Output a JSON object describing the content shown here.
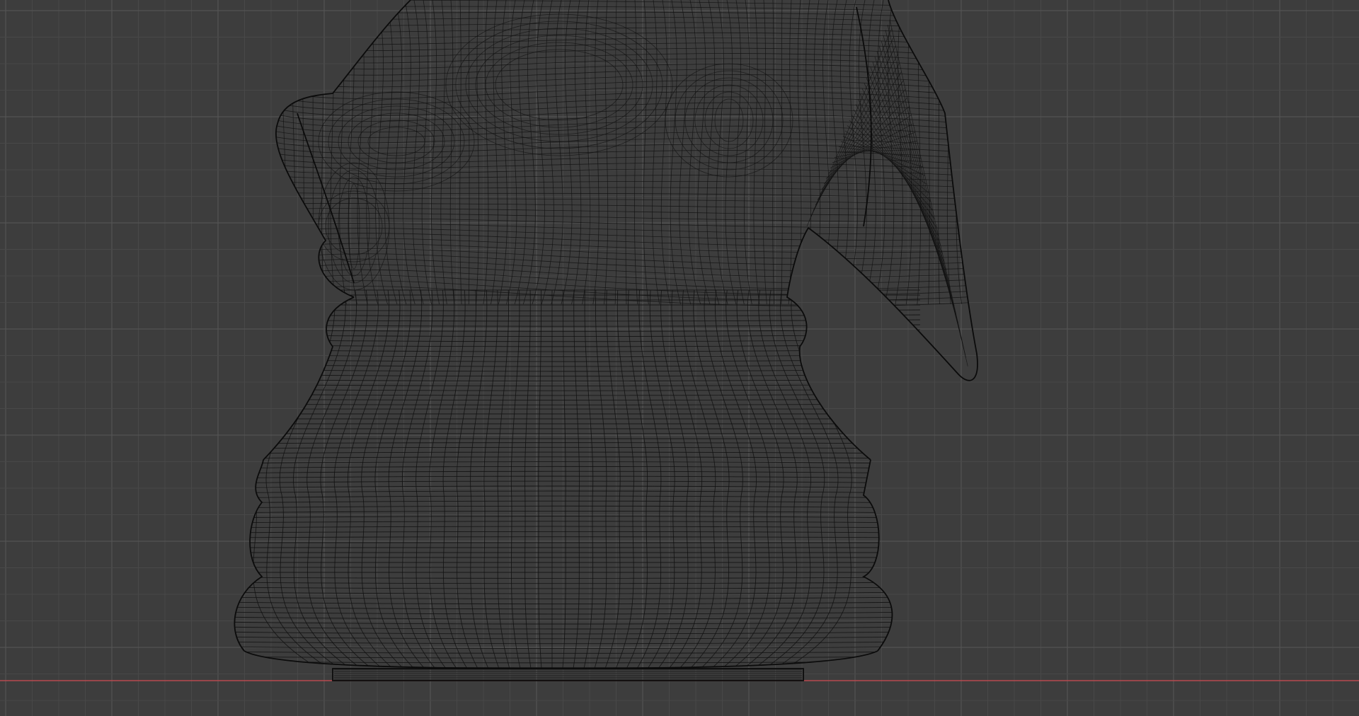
{
  "viewport": {
    "view_mode": "wireframe",
    "object": "knight-chess-piece-mesh",
    "colors": {
      "background": "#3d3d3d",
      "grid_minor": "#484848",
      "grid_major": "#565656",
      "wire": "#111111",
      "x_axis": "#b84a4e"
    },
    "grid_visible": true,
    "axis_visible": "x"
  }
}
